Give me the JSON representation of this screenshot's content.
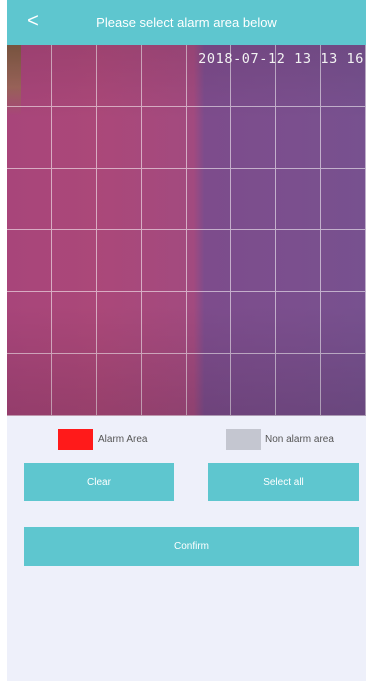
{
  "header": {
    "back_icon": "<",
    "title": "Please select alarm area below"
  },
  "camera": {
    "timestamp": "2018-07-12 13 13 16",
    "grid": {
      "columns": 8,
      "rows": 6
    },
    "line_color": "#ffffff"
  },
  "legend": {
    "alarm": {
      "label": "Alarm Area",
      "color": "#ff1a1a"
    },
    "non_alarm": {
      "label": "Non alarm area",
      "color": "#c4c6d0"
    }
  },
  "buttons": {
    "clear": "Clear",
    "select_all": "Select all",
    "confirm": "Confirm"
  },
  "colors": {
    "accent": "#5ec6cf",
    "background": "#eef0fa"
  }
}
